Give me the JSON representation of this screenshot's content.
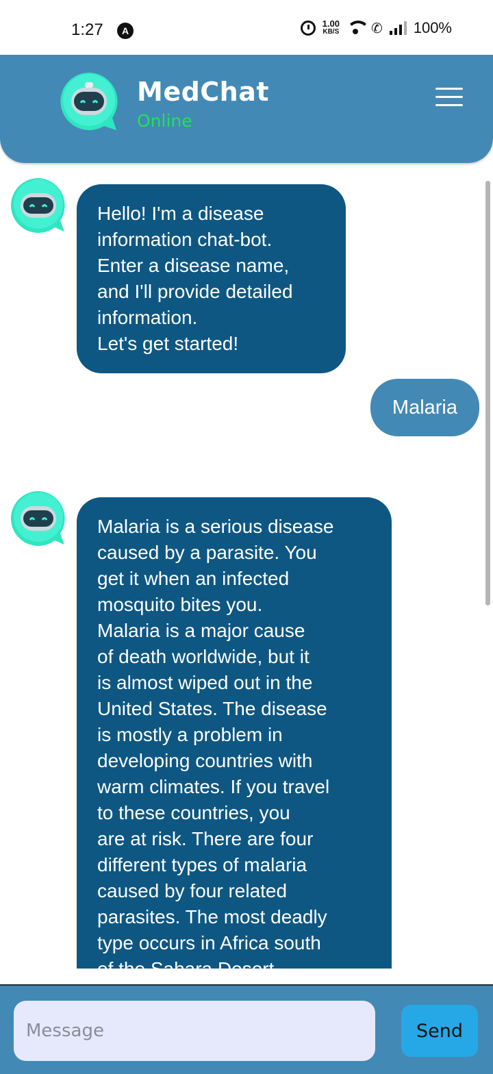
{
  "status_bar": {
    "time": "1:27",
    "notification_letter": "A",
    "speed_value": "1.00",
    "speed_unit": "KB/S",
    "battery": "100%"
  },
  "header": {
    "title": "MedChat",
    "status": "Online",
    "status_color": "#22e05a",
    "background_color": "#4389b5",
    "logo_icon": "robot-chat-icon",
    "menu_icon": "hamburger-menu-icon"
  },
  "messages": [
    {
      "sender": "bot",
      "text": "Hello! I'm a disease\ninformation chat-bot.\nEnter a disease name,\nand I'll provide detailed\ninformation.\nLet's get started!"
    },
    {
      "sender": "user",
      "text": "Malaria"
    },
    {
      "sender": "bot",
      "text": "Malaria is a serious disease\ncaused by a parasite. You\nget it when an infected\nmosquito bites you.\nMalaria is a major cause\nof death worldwide, but it\nis almost wiped out in the\nUnited States. The disease\nis mostly a problem in\ndeveloping countries with\nwarm climates. If you travel\nto these countries, you\nare at risk. There are four\ndifferent types of malaria\ncaused by four related\nparasites. The most deadly\ntype occurs in Africa south\nof the Sahara Desert."
    }
  ],
  "input": {
    "placeholder": "Message",
    "value": "",
    "send_label": "Send"
  },
  "colors": {
    "bot_bubble": "#0e5783",
    "user_bubble": "#4389b5",
    "send_button": "#26a8e6",
    "input_background": "#e6e9fb"
  }
}
